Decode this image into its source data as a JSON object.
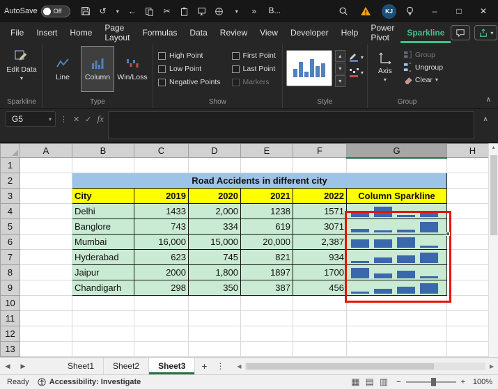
{
  "colors": {
    "accent_green": "#3fc387",
    "excel_green": "#217346",
    "sparkline_bar": "#3a68ad",
    "highlight_red": "#e51400",
    "title_fill": "#9dc3e6",
    "header_fill": "#ffff00",
    "data_fill": "#c9ead3",
    "warning_orange": "#f0a30a"
  },
  "icons": {
    "undo": "↺",
    "back": "←",
    "cut": "✂",
    "chevron_down": "▾",
    "overflow": "»",
    "minimize": "–",
    "maximize": "□",
    "close": "✕",
    "cancel": "✕",
    "enter": "✓",
    "fx": "fx",
    "kebab": "⋮",
    "collapse": "∧",
    "expand_formula": "∧",
    "nav_left": "◀",
    "nav_right": "▶",
    "plus": "+",
    "tab_more": "⋮",
    "view_normal": "▦",
    "view_layout": "▤",
    "view_break": "▥",
    "zoom_out": "−",
    "zoom_in": "+",
    "gallery_up": "▴",
    "gallery_down": "▾",
    "gallery_more": "▾"
  },
  "titlebar": {
    "autosave_label": "AutoSave",
    "autosave_state": "Off",
    "workbook_label": "B...",
    "avatar_initials": "KJ"
  },
  "menu": {
    "tabs": [
      "File",
      "Insert",
      "Home",
      "Page Layout",
      "Formulas",
      "Data",
      "Review",
      "View",
      "Developer",
      "Help",
      "Power Pivot",
      "Sparkline"
    ],
    "active_tab": "Sparkline"
  },
  "ribbon": {
    "edit_data_label": "Edit Data",
    "sparkline_group_label": "Sparkline",
    "type_buttons": [
      "Line",
      "Column",
      "Win/Loss"
    ],
    "type_active": "Column",
    "type_group_label": "Type",
    "show_items": [
      {
        "label": "High Point",
        "disabled": false
      },
      {
        "label": "First Point",
        "disabled": false
      },
      {
        "label": "Low Point",
        "disabled": false
      },
      {
        "label": "Last Point",
        "disabled": false
      },
      {
        "label": "Negative Points",
        "disabled": false
      },
      {
        "label": "Markers",
        "disabled": true
      }
    ],
    "show_group_label": "Show",
    "style_group_label": "Style",
    "axis_label": "Axis",
    "group_label": "Group",
    "ungroup_label": "Ungroup",
    "clear_label": "Clear",
    "group_group_label": "Group"
  },
  "formula_bar": {
    "name_box": "G5"
  },
  "sheet": {
    "col_headers": [
      "A",
      "B",
      "C",
      "D",
      "E",
      "F",
      "G",
      "H"
    ],
    "selected_col": "G",
    "row_count": 13,
    "title": "Road Accidents in different city",
    "table_headers": [
      "City",
      "2019",
      "2020",
      "2021",
      "2022",
      "Column Sparkline"
    ],
    "rows": [
      {
        "cells": [
          "Delhi",
          "1433",
          "2,000",
          "1238",
          "1571"
        ],
        "values": [
          1433,
          2000,
          1238,
          1571
        ]
      },
      {
        "cells": [
          "Banglore",
          "743",
          "334",
          "619",
          "3071"
        ],
        "values": [
          743,
          334,
          619,
          3071
        ]
      },
      {
        "cells": [
          "Mumbai",
          "16,000",
          "15,000",
          "20,000",
          "2,387"
        ],
        "values": [
          16000,
          15000,
          20000,
          2387
        ]
      },
      {
        "cells": [
          "Hyderabad",
          "623",
          "745",
          "821",
          "934"
        ],
        "values": [
          623,
          745,
          821,
          934
        ]
      },
      {
        "cells": [
          "Jaipur",
          "2000",
          "1,800",
          "1897",
          "1700"
        ],
        "values": [
          2000,
          1800,
          1897,
          1700
        ]
      },
      {
        "cells": [
          "Chandigarh",
          "298",
          "350",
          "387",
          "456"
        ],
        "values": [
          298,
          350,
          387,
          456
        ]
      }
    ]
  },
  "tabs_bar": {
    "sheets": [
      "Sheet1",
      "Sheet2",
      "Sheet3"
    ],
    "active": "Sheet3"
  },
  "status_bar": {
    "ready": "Ready",
    "accessibility": "Accessibility: Investigate",
    "zoom": "100%"
  }
}
